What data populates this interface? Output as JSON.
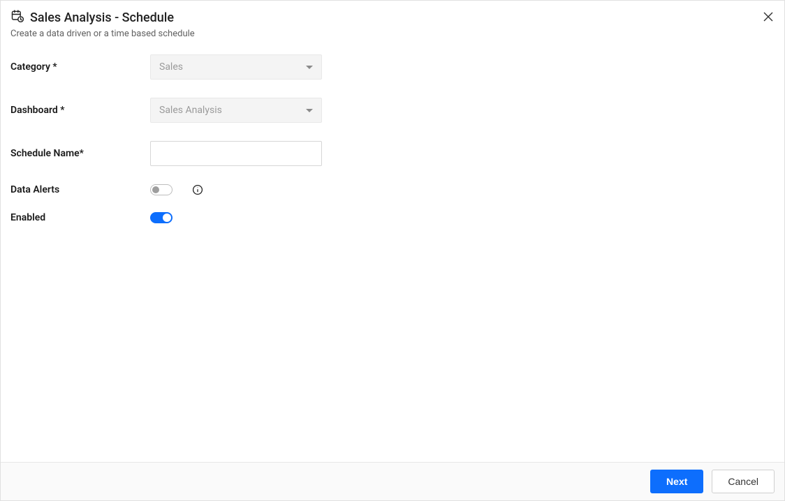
{
  "header": {
    "title": "Sales Analysis - Schedule",
    "subtitle": "Create a data driven or a time based schedule"
  },
  "form": {
    "category": {
      "label": "Category *",
      "value": "Sales"
    },
    "dashboard": {
      "label": "Dashboard *",
      "value": "Sales Analysis"
    },
    "schedule_name": {
      "label": "Schedule Name*",
      "value": ""
    },
    "data_alerts": {
      "label": "Data Alerts",
      "on": false
    },
    "enabled": {
      "label": "Enabled",
      "on": true
    }
  },
  "footer": {
    "next": "Next",
    "cancel": "Cancel"
  }
}
